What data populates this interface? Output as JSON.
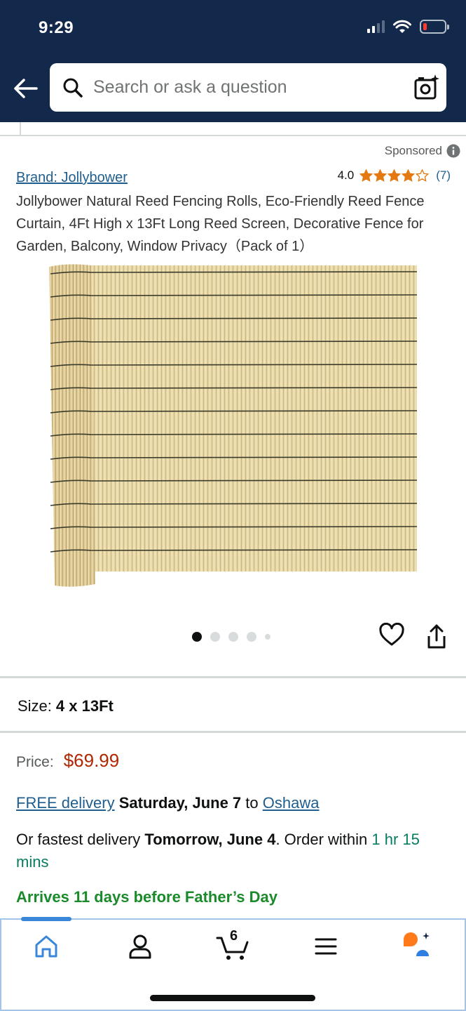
{
  "status_bar": {
    "time": "9:29"
  },
  "search": {
    "placeholder": "Search or ask a question"
  },
  "listing": {
    "sponsored_label": "Sponsored",
    "brand": "Brand: Jollybower",
    "rating_value": "4.0",
    "rating_stars": 4,
    "rating_count": "(7)",
    "title": "Jollybower Natural Reed Fencing Rolls, Eco-Friendly Reed Fence Curtain, 4Ft High x 13Ft Long Reed Screen, Decorative Fence for Garden, Balcony, Window Privacy（Pack of 1）",
    "image_count": 5,
    "active_image": 1
  },
  "size": {
    "label": "Size:",
    "value": "4 x 13Ft"
  },
  "price": {
    "label": "Price:",
    "value": "$69.99"
  },
  "delivery": {
    "free_label": "FREE delivery",
    "date": "Saturday, June 7",
    "to_text": "to",
    "location": "Oshawa",
    "fastest_prefix": "Or fastest delivery",
    "fastest_date": "Tomorrow, June 4",
    "order_within_text": ". Order within",
    "time_left": "1 hr 15 mins",
    "arrives_note": "Arrives 11 days before Father’s Day"
  },
  "tabbar": {
    "cart_count": "6",
    "active_tab": "home"
  },
  "colors": {
    "header_bg": "#13294b",
    "link": "#1f5e8e",
    "price": "#b12704",
    "star": "#e47911",
    "arrives": "#1a8a2a",
    "accent": "#3a87d9"
  }
}
